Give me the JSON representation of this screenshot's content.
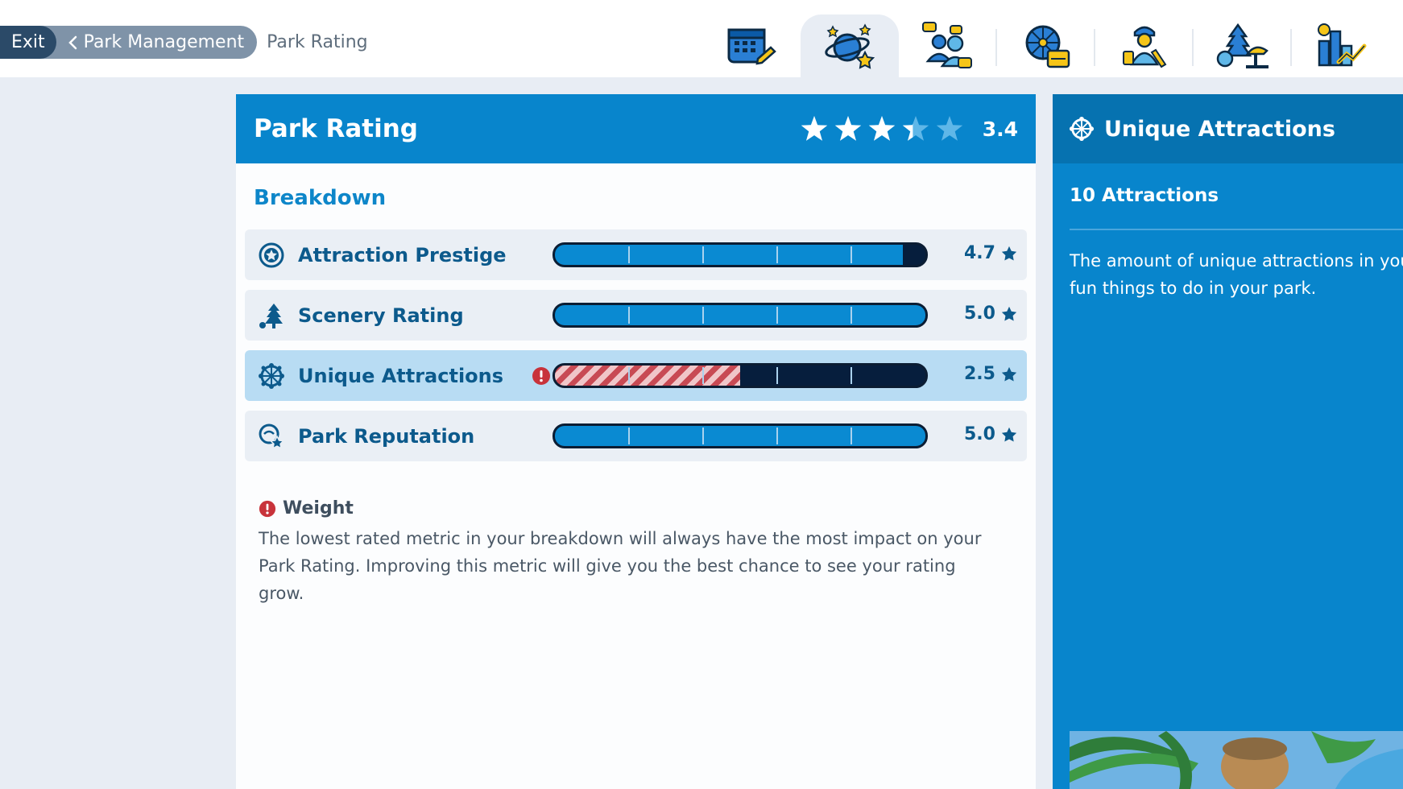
{
  "breadcrumb": {
    "exit_label": "Exit",
    "back_label": "Park Management",
    "current_label": "Park Rating"
  },
  "tabs": [
    {
      "icon": "calendar-icon",
      "active": false
    },
    {
      "icon": "planet-star-icon",
      "active": true
    },
    {
      "icon": "guests-icon",
      "active": false
    },
    {
      "icon": "ferris-wheel-icon",
      "active": false
    },
    {
      "icon": "staff-icon",
      "active": false
    },
    {
      "icon": "scenery-icon",
      "active": false
    },
    {
      "icon": "finance-chart-icon",
      "active": false
    }
  ],
  "panel": {
    "title": "Park Rating",
    "rating_value": "3.4",
    "rating_stars": 3.4,
    "breakdown_title": "Breakdown",
    "metrics": [
      {
        "label": "Attraction Prestige",
        "value": "4.7",
        "fraction": 0.94,
        "icon": "star-badge-icon",
        "warning": false,
        "highlighted": false
      },
      {
        "label": "Scenery Rating",
        "value": "5.0",
        "fraction": 1.0,
        "icon": "tree-icon",
        "warning": false,
        "highlighted": false
      },
      {
        "label": "Unique Attractions",
        "value": "2.5",
        "fraction": 0.5,
        "icon": "ferris-wheel-icon",
        "warning": true,
        "highlighted": true
      },
      {
        "label": "Park Reputation",
        "value": "5.0",
        "fraction": 1.0,
        "icon": "reputation-icon",
        "warning": false,
        "highlighted": false
      }
    ],
    "weight_title": "Weight",
    "weight_text": "The lowest rated metric in your breakdown will always have the most impact on your Park Rating. Improving this metric will give you the best chance to see your rating grow."
  },
  "side": {
    "title": "Unique Attractions",
    "count": "10 Attractions",
    "description_line1": "The amount of unique attractions in your p",
    "description_line2": "fun things to do in your park."
  },
  "colors": {
    "accent": "#0885cc",
    "bar_fill": "#0a8ad2",
    "warning": "#c8333b",
    "star_empty": "#5fb7e8"
  }
}
